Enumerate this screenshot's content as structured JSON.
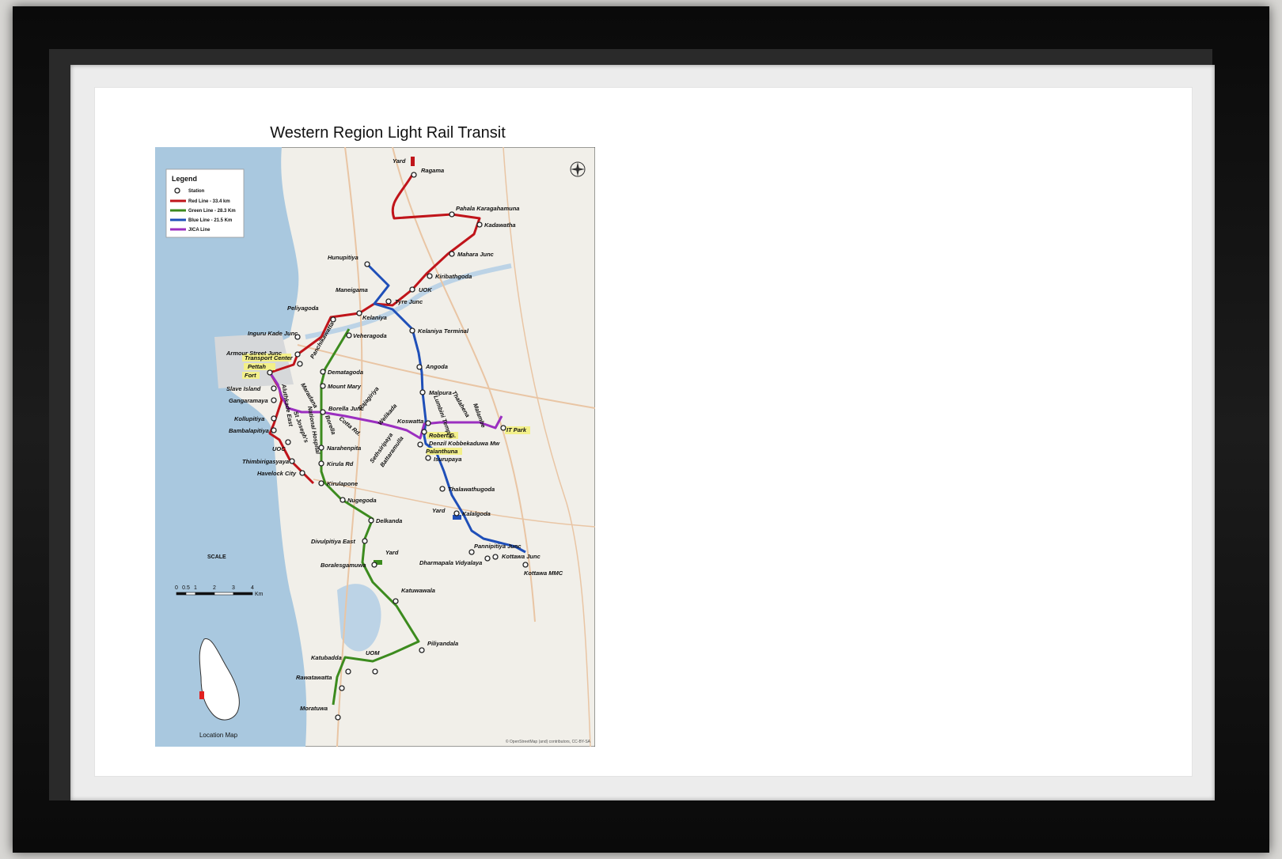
{
  "title": "Western Region Light Rail Transit",
  "legend": {
    "title": "Legend",
    "station": "Station",
    "lines": [
      {
        "label": "Red Line - 33.4 km",
        "color": "#c0141a"
      },
      {
        "label": "Green Line - 28.3 Km",
        "color": "#3c8b1e"
      },
      {
        "label": "Blue Line - 21.5 Km",
        "color": "#1f4fb8"
      },
      {
        "label": "JICA Line",
        "color": "#9b2fc0"
      }
    ]
  },
  "scale": {
    "title": "SCALE",
    "ticks": [
      "0",
      "0.5",
      "1",
      "2",
      "3",
      "4"
    ],
    "unit": "Km"
  },
  "location_map_label": "Location Map",
  "attribution": "© OpenStreetMap (and) contributors, CC-BY-SA",
  "yard_label": "Yard",
  "stations": {
    "ragama": "Ragama",
    "pahala": "Pahala Karagahamuna",
    "kadawatha": "Kadawatha",
    "mahara": "Mahara Junc",
    "kiribathgoda": "Kiribathgoda",
    "uok": "UOK",
    "tyre": "Tyre Junc",
    "hunupitiya": "Hunupitiya",
    "maneigama": "Maneigama",
    "kelaniya": "Kelaniya",
    "peliyagoda": "Peliyagoda",
    "inguru": "Inguru Kade Junc",
    "veheragoda": "Veheragoda",
    "kelaniya_terminal": "Kelaniya Terminal",
    "armour": "Armour Street Junc",
    "panchikawatta": "Panchikawatta",
    "transport_center": "Transport Center",
    "pettah": "Pettah",
    "fort": "Fort",
    "dematagoda": "Dematagoda",
    "mount_mary": "Mount Mary",
    "angoda": "Angoda",
    "slave_island": "Slave Island",
    "gangaramaya": "Gangaramaya",
    "kollupitiya": "Kollupitiya",
    "bambalapitiya": "Bambalapitiya",
    "uoc": "UOC",
    "thimbirigasyaya": "Thimbirigasyaya",
    "havelock": "Havelock City",
    "malpura": "Malpura",
    "borella_junc": "Borella Junc",
    "koswatta": "Koswatta",
    "robert": "Robert G.",
    "denzil": "Denzil Kobbekaduwa Mw",
    "palanthuna": "Palanthuna",
    "isurupaya": "Isurupaya",
    "it_park": "IT Park",
    "narahenpita": "Narahenpita",
    "kirula": "Kirula Rd",
    "kirulapone": "Kirulapone",
    "nugegoda": "Nugegoda",
    "thalawathugoda": "Thalawathugoda",
    "kalalgoda": "Kalalgoda",
    "delkanda": "Delkanda",
    "divulpitiya": "Divulpitiya East",
    "boralesgamuwa": "Boralesgamuwa",
    "pannipitiya": "Pannipitiya Junc",
    "kottawa_junc": "Kottawa Junc",
    "dharmapala": "Dharmapala Vidyalaya",
    "kottawa_mmc": "Kottawa MMC",
    "katuwawala": "Katuwawala",
    "piliyandala": "Piliyandala",
    "uom": "UOM",
    "katubadda": "Katubadda",
    "rawatawatta": "Rawatawatta",
    "moratuwa": "Moratuwa",
    "maradana": "Maradana",
    "alutmawatha": "Aluthkade East",
    "st_josephs": "St Joseph's",
    "national_hospital": "National Hospital",
    "borella": "Borella",
    "cotta_rd": "Cotta Rd.",
    "rajagiriya": "Rajagiriya",
    "welikada": "Welikada",
    "sethsiripaya": "Sethsiripaya",
    "battaramulla": "Battaramulla",
    "lumbini": "Lumbini Temple",
    "thalahena": "Thalahena",
    "malambe": "Malambe"
  }
}
